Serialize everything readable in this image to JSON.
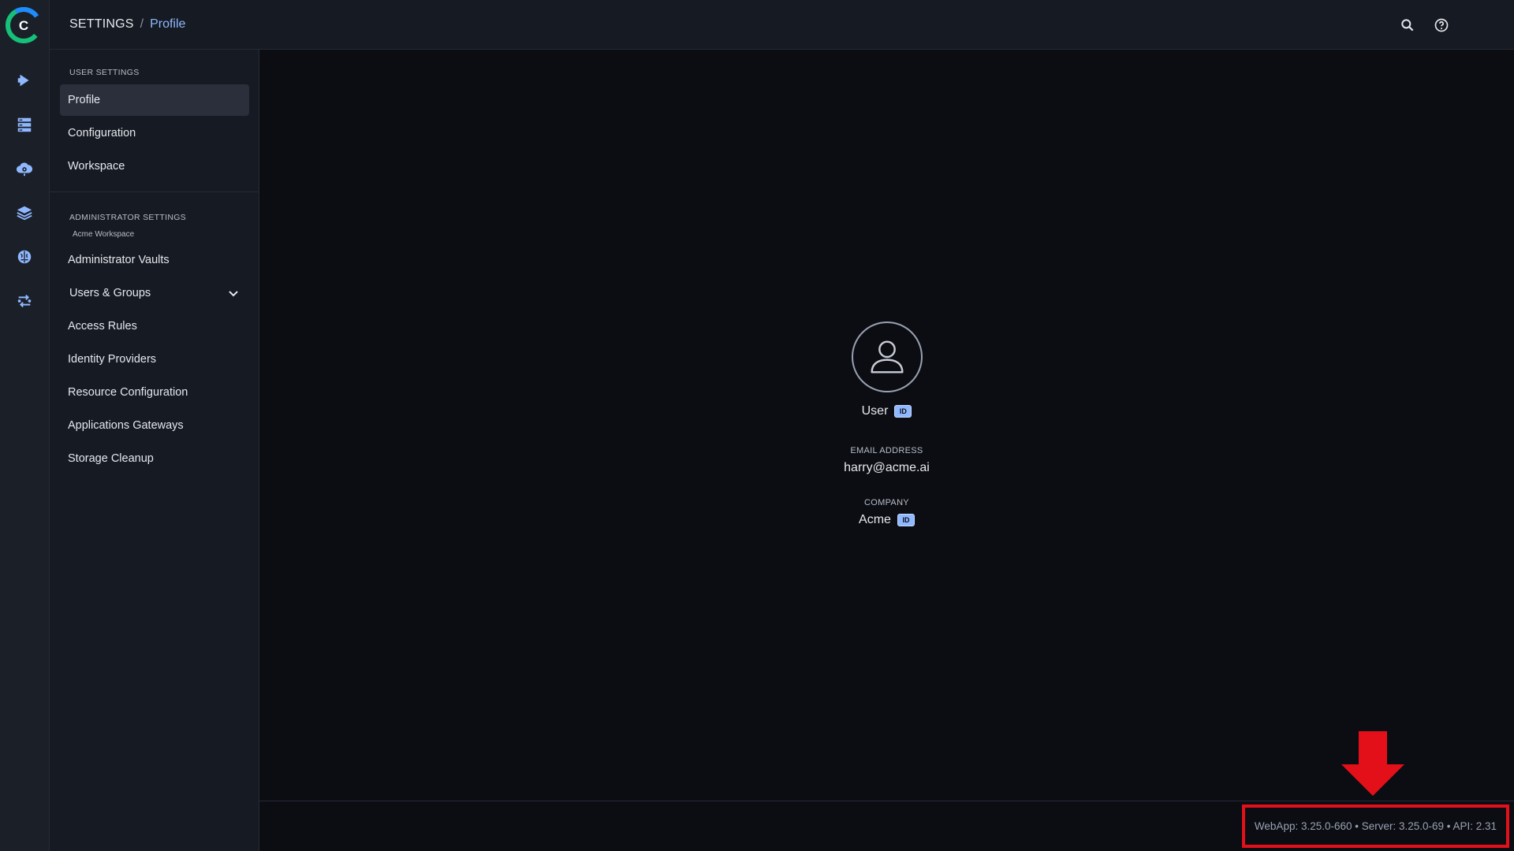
{
  "header": {
    "breadcrumb_root": "SETTINGS",
    "breadcrumb_separator": "/",
    "breadcrumb_current": "Profile",
    "icons": [
      "search-icon",
      "help-icon",
      "user-avatar-icon"
    ]
  },
  "rail": {
    "logo_letter": "C",
    "icons": [
      "arrow-right-icon",
      "server-icon",
      "cloud-gear-icon",
      "layers-icon",
      "brain-icon",
      "pipeline-icon"
    ]
  },
  "sidebar": {
    "user_section_title": "USER SETTINGS",
    "user_items": [
      {
        "label": "Profile",
        "active": true
      },
      {
        "label": "Configuration",
        "active": false
      },
      {
        "label": "Workspace",
        "active": false
      }
    ],
    "admin_section_title": "ADMINISTRATOR SETTINGS",
    "admin_section_sub": "Acme Workspace",
    "admin_items": [
      {
        "label": "Administrator Vaults"
      },
      {
        "label": "Users & Groups",
        "expandable": true
      },
      {
        "label": "Access Rules"
      },
      {
        "label": "Identity Providers"
      },
      {
        "label": "Resource Configuration"
      },
      {
        "label": "Applications Gateways"
      },
      {
        "label": "Storage Cleanup"
      }
    ]
  },
  "profile": {
    "name": "User",
    "id_badge": "ID",
    "email_label": "EMAIL ADDRESS",
    "email_value": "harry@acme.ai",
    "company_label": "COMPANY",
    "company_value": "Acme",
    "company_badge": "ID"
  },
  "footer": {
    "version_text": "WebApp: 3.25.0-660 • Server: 3.25.0-69 • API: 2.31"
  },
  "colors": {
    "accent": "#8fb8ff",
    "annotation": "#e3101a",
    "background": "#0b0d13",
    "panel": "#161a22"
  }
}
